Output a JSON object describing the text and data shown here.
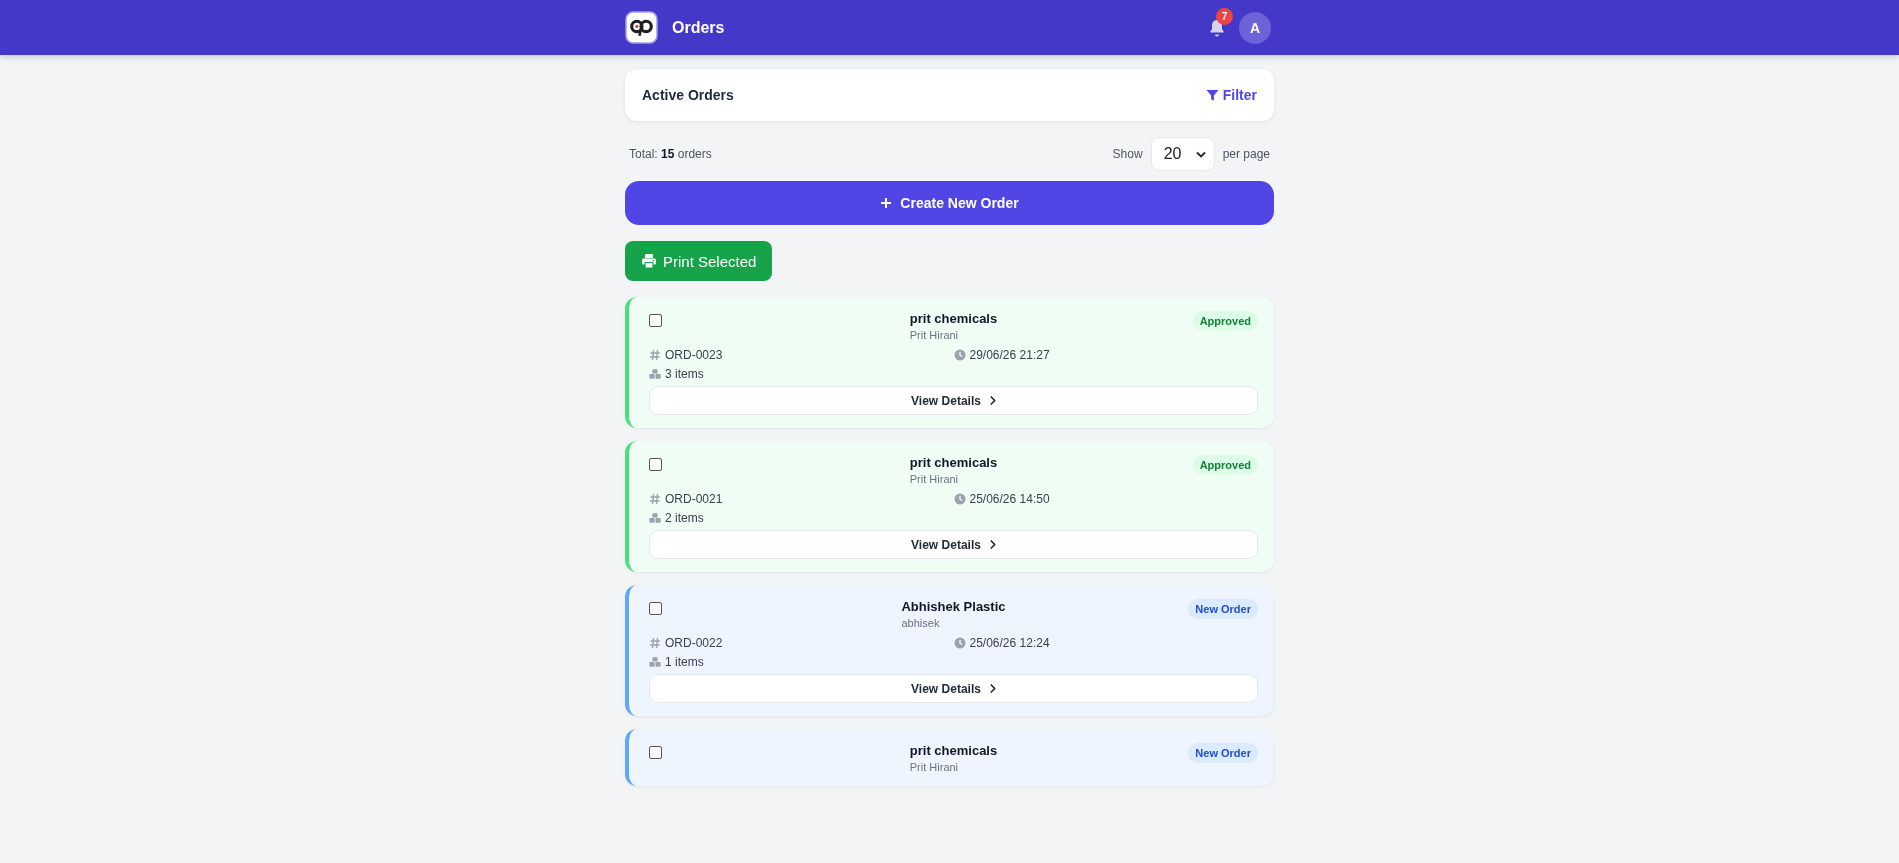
{
  "header": {
    "title": "Orders",
    "notification_count": "7",
    "avatar_initial": "A"
  },
  "panel": {
    "title": "Active Orders",
    "filter_label": "Filter"
  },
  "summary": {
    "total_prefix": "Total:",
    "total_count": "15",
    "total_suffix": "orders",
    "show_label": "Show",
    "page_size": "20",
    "per_page_label": "per page"
  },
  "create_button": "Create New Order",
  "print_button": "Print Selected",
  "orders": [
    {
      "name": "prit chemicals",
      "contact": "Prit Hirani",
      "status": "Approved",
      "kind": "approved",
      "checked": false,
      "order_id": "ORD-0023",
      "date": "29/06/26 21:27",
      "items": "3 items",
      "action": "View Details"
    },
    {
      "name": "prit chemicals",
      "contact": "Prit Hirani",
      "status": "Approved",
      "kind": "approved",
      "checked": false,
      "order_id": "ORD-0021",
      "date": "25/06/26 14:50",
      "items": "2 items",
      "action": "View Details"
    },
    {
      "name": "Abhishek Plastic",
      "contact": "abhisek",
      "status": "New Order",
      "kind": "new",
      "checked": false,
      "order_id": "ORD-0022",
      "date": "25/06/26 12:24",
      "items": "1 items",
      "action": "View Details"
    },
    {
      "name": "prit chemicals",
      "contact": "Prit Hirani",
      "status": "New Order",
      "kind": "new",
      "checked": false
    }
  ]
}
